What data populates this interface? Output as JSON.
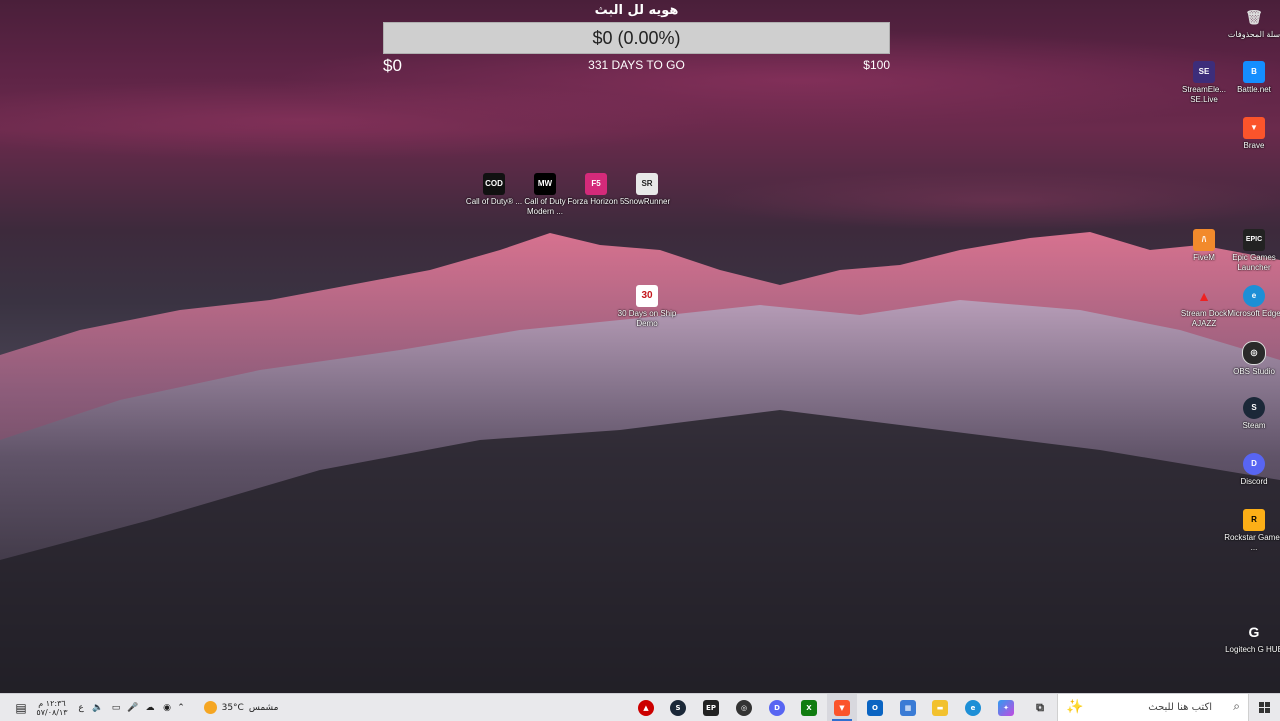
{
  "widget": {
    "title": "هويه لل البث",
    "bar_text": "$0 (0.00%)",
    "progress_fraction": 0.0,
    "start_amount": "$0",
    "days_to_go": "331 DAYS TO GO",
    "goal_amount": "$100"
  },
  "desktop_icons_center": [
    {
      "label": "Call of Duty® ...",
      "icon": "call-of-duty-icon"
    },
    {
      "label": "Call of Duty Modern ...",
      "icon": "mw-icon"
    },
    {
      "label": "Forza Horizon 5",
      "icon": "forza-icon"
    },
    {
      "label": "SnowRunner",
      "icon": "snowrunner-icon"
    },
    {
      "label": "30 Days on Ship Demo",
      "icon": "30-days-icon"
    }
  ],
  "desktop_icons_right": [
    {
      "label": "سلة المحذوفات",
      "icon": "recycle-bin-icon"
    },
    {
      "label": "Battle.net",
      "icon": "battle-net-icon"
    },
    {
      "label": "StreamEle... SE.Live",
      "icon": "streamelements-icon"
    },
    {
      "label": "Brave",
      "icon": "brave-icon"
    },
    {
      "label": "Epic Games Launcher",
      "icon": "epic-games-icon"
    },
    {
      "label": "FiveM",
      "icon": "fivem-icon"
    },
    {
      "label": "Microsoft Edge",
      "icon": "edge-icon"
    },
    {
      "label": "Stream Dock AJAZZ",
      "icon": "stream-dock-icon"
    },
    {
      "label": "OBS Studio",
      "icon": "obs-icon"
    },
    {
      "label": "Steam",
      "icon": "steam-icon"
    },
    {
      "label": "Discord",
      "icon": "discord-icon"
    },
    {
      "label": "Rockstar Games ...",
      "icon": "rockstar-icon"
    },
    {
      "label": "Logitech G HUB",
      "icon": "logitech-icon"
    }
  ],
  "taskbar": {
    "search_placeholder": "اكتب هنا للبحث",
    "weather_temp": "35°C",
    "weather_text": "مشمس",
    "clock_time": "١٢:٣٦ م",
    "clock_date": "٥٧/٠٨/١٣",
    "lang": "ع",
    "apps": [
      "stream-dock-icon",
      "steam-icon",
      "epic-games-icon",
      "obs-icon",
      "discord-icon",
      "xbox-icon",
      "brave-icon",
      "outlook-icon",
      "store-icon",
      "file-explorer-icon",
      "edge-icon",
      "copilot-icon",
      "task-view-icon"
    ]
  },
  "colors": {
    "bar_bg": "#cfcfcf",
    "taskbar_bg": "#e9e9ec",
    "accent": "#2f6fd1"
  }
}
